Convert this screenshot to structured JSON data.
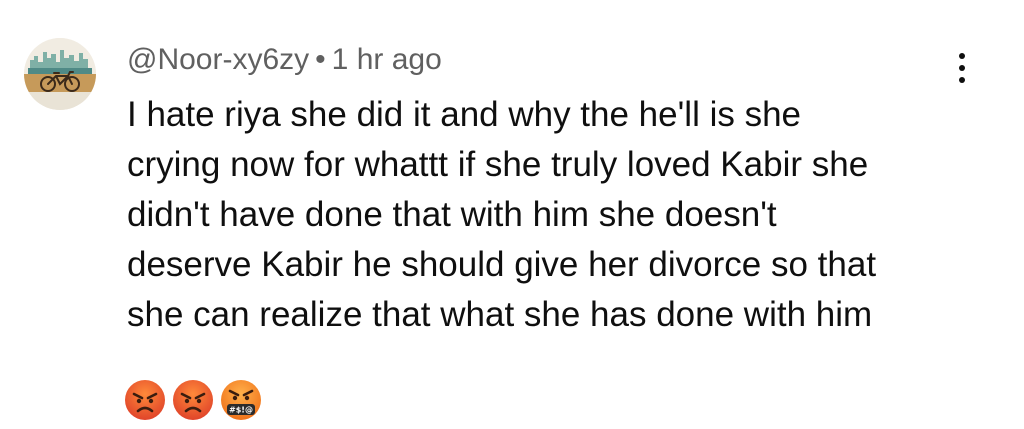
{
  "comment": {
    "author": "@Noor-xy6zy",
    "separator": "•",
    "timestamp": "1 hr ago",
    "text_lines": [
      "I hate riya she did it and why the he'll is she",
      "crying now for whattt if she truly loved Kabir she",
      "didn't have done that with him she doesn't",
      "deserve Kabir he should give her divorce so that",
      "she can realize that what she has done with him"
    ],
    "emojis": [
      {
        "icon": "angry-face-emoji",
        "glyph": "😡"
      },
      {
        "icon": "angry-face-emoji",
        "glyph": "😡"
      },
      {
        "icon": "cursing-face-emoji",
        "glyph": "🤬",
        "symbols": "#$!@"
      }
    ]
  },
  "colors": {
    "text": "#0f0f0f",
    "meta": "#606060",
    "background": "#ffffff",
    "emoji_red": "#e0442a",
    "emoji_orange": "#f0731c"
  },
  "icons": {
    "avatar": "bicycle-cityscape-avatar",
    "menu": "more-vertical-icon"
  }
}
